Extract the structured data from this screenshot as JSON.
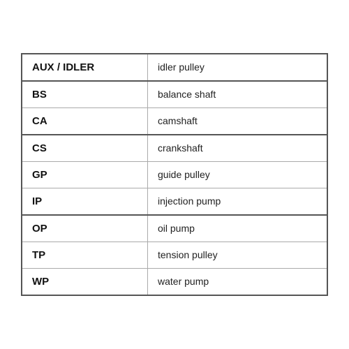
{
  "table": {
    "rows": [
      {
        "abbr": "AUX / IDLER",
        "desc": "idler pulley",
        "thickBottom": true
      },
      {
        "abbr": "BS",
        "desc": "balance shaft",
        "thickBottom": false
      },
      {
        "abbr": "CA",
        "desc": "camshaft",
        "thickBottom": true
      },
      {
        "abbr": "CS",
        "desc": "crankshaft",
        "thickBottom": false
      },
      {
        "abbr": "GP",
        "desc": "guide pulley",
        "thickBottom": false
      },
      {
        "abbr": "IP",
        "desc": "injection pump",
        "thickBottom": true
      },
      {
        "abbr": "OP",
        "desc": "oil pump",
        "thickBottom": false
      },
      {
        "abbr": "TP",
        "desc": "tension pulley",
        "thickBottom": false
      },
      {
        "abbr": "WP",
        "desc": "water pump",
        "thickBottom": false
      }
    ]
  }
}
